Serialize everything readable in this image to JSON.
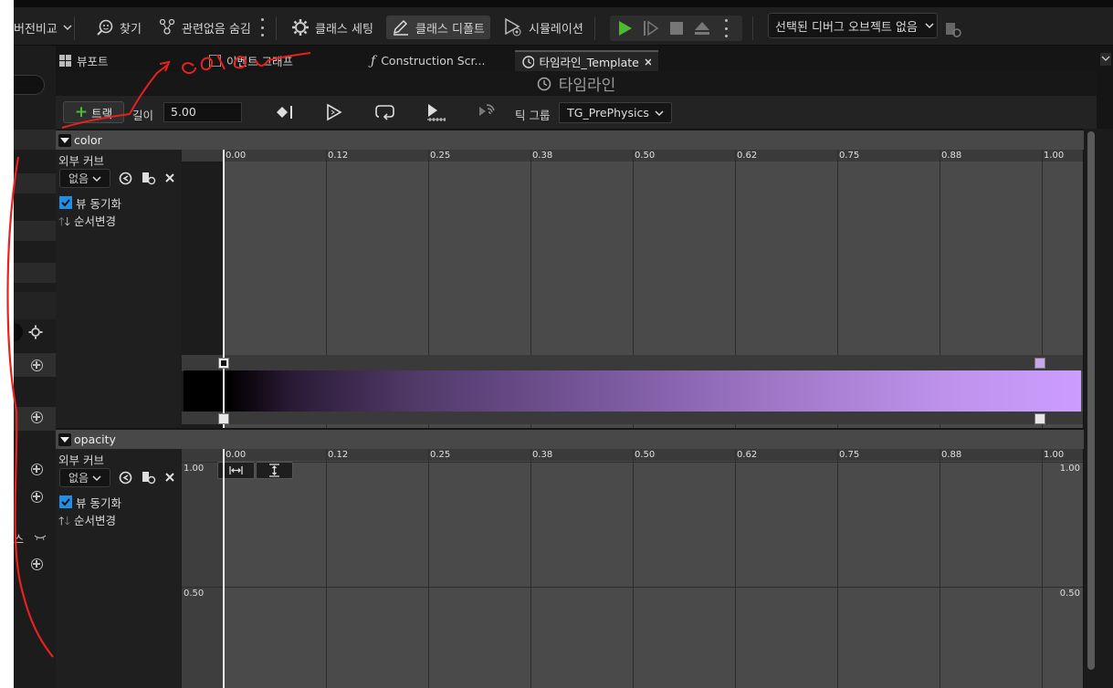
{
  "toolbar": {
    "diff_label": "버전비교",
    "find_label": "찾기",
    "hide_unrelated_label": "관련없음 숨김",
    "class_settings_label": "클래스 세팅",
    "class_defaults_label": "클래스 디폴트",
    "simulation_label": "시뮬레이션",
    "debug_object_label": "선택된 디버그 오브젝트 없음"
  },
  "tabs": [
    {
      "label": "뷰포트",
      "icon": "viewport-grid-icon"
    },
    {
      "label": "이벤트 그래프",
      "icon": "graph-icon"
    },
    {
      "label": "Construction Scr...",
      "icon": "function-icon"
    },
    {
      "label": "타임라인_Template",
      "icon": "clock-icon",
      "active": true
    }
  ],
  "timeline": {
    "title": "타임라인",
    "add_track_label": "트랙",
    "length_label": "길이",
    "length_value": "5.00",
    "tick_group_label": "틱 그룹",
    "tick_group_value": "TG_PrePhysics"
  },
  "ruler_ticks": [
    "0.00",
    "0.12",
    "0.25",
    "0.38",
    "0.50",
    "0.62",
    "0.75",
    "0.88",
    "1.00"
  ],
  "tracks": [
    {
      "name": "color",
      "external_curve_label": "외부 커브",
      "curve_select_value": "없음",
      "sync_view_label": "뷰 동기화",
      "sync_view_checked": true,
      "reorder_label": "순서변경",
      "gradient_start": "#000000",
      "gradient_end": "#cc9dff"
    },
    {
      "name": "opacity",
      "external_curve_label": "외부 커브",
      "curve_select_value": "없음",
      "sync_view_label": "뷰 동기화",
      "sync_view_checked": true,
      "reorder_label": "순서변경",
      "value_labels": [
        "1.00",
        "0.50"
      ]
    }
  ],
  "left_panel": {
    "partial_label": "스"
  },
  "annotation": {
    "handwritten_text": "color",
    "ink_color": "#e8211e"
  },
  "colors": {
    "accent_play": "#4cbb2f",
    "checkbox": "#1f8fe6"
  }
}
